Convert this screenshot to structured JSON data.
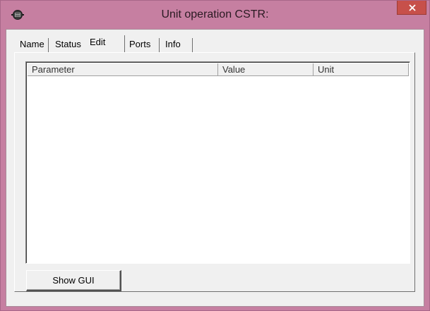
{
  "window": {
    "title": "Unit operation CSTR:",
    "close_glyph": "×"
  },
  "tabs": [
    {
      "label": "Name",
      "active": false
    },
    {
      "label": "Status",
      "active": false
    },
    {
      "label": "Edit",
      "active": true
    },
    {
      "label": "Ports",
      "active": false
    },
    {
      "label": "Info",
      "active": false
    }
  ],
  "table": {
    "columns": [
      "Parameter",
      "Value",
      "Unit"
    ],
    "rows": []
  },
  "buttons": {
    "show_gui_label": "Show GUI"
  },
  "icons": {
    "window_icon": "unit-operation-icon",
    "close": "close-icon"
  },
  "colors": {
    "frame": "#c67fa1",
    "close_button": "#c7504a",
    "client_background": "#f0f0f0"
  }
}
